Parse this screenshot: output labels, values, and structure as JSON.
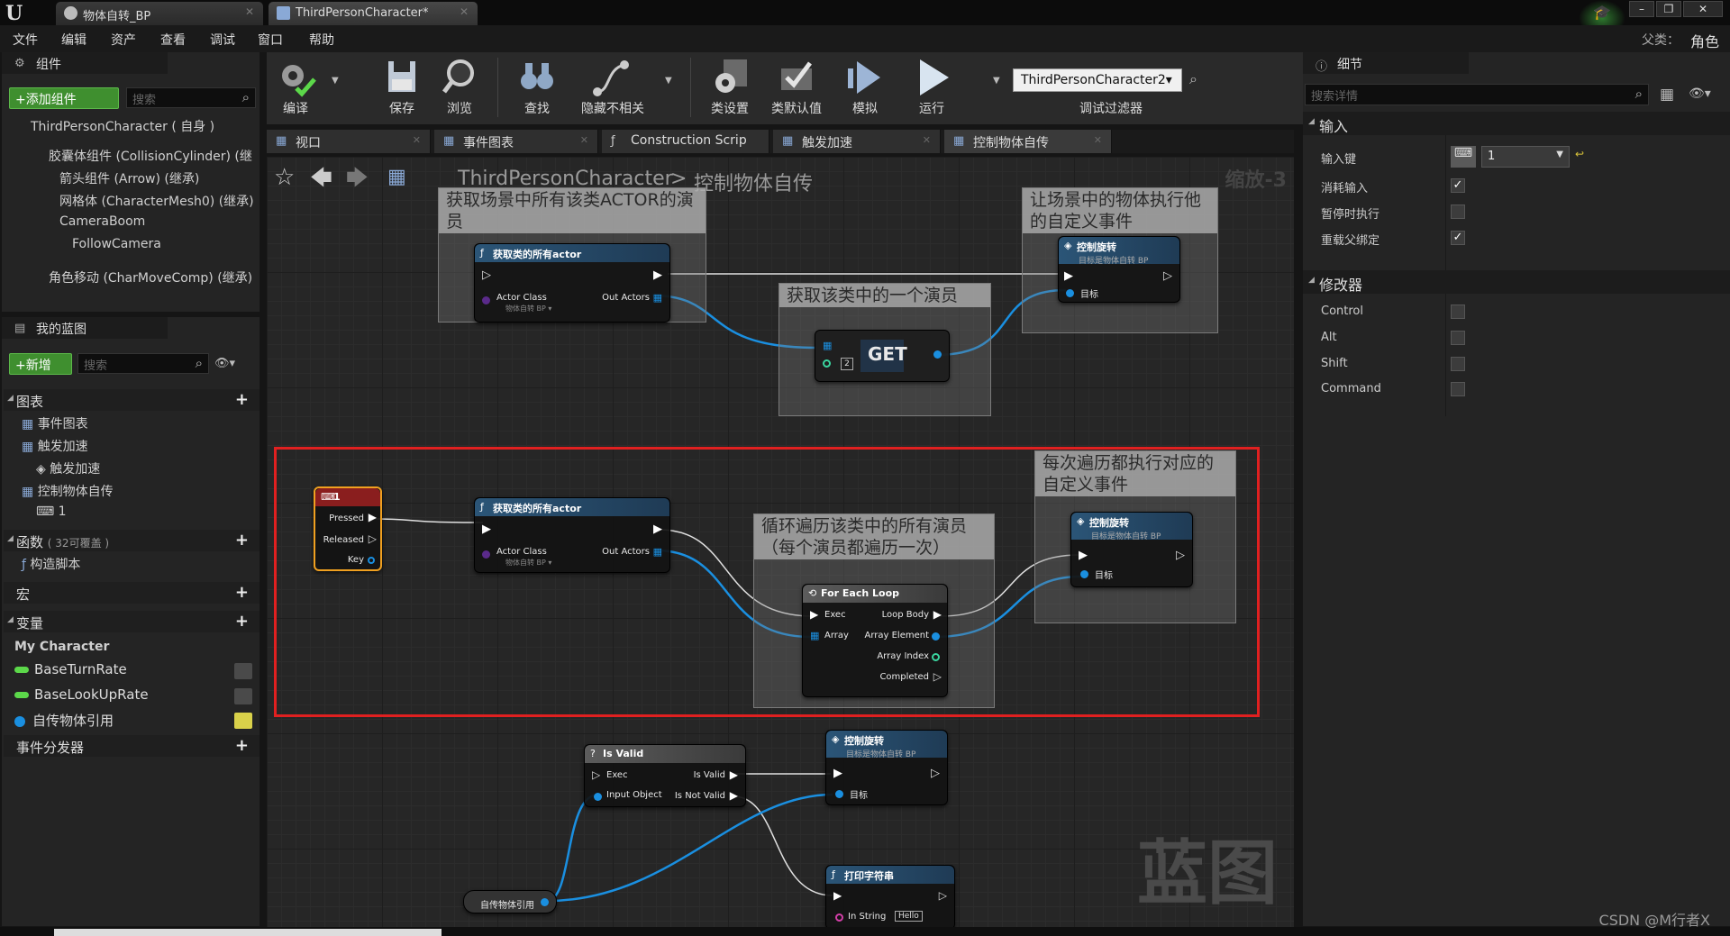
{
  "titlebar": {
    "tabs": [
      {
        "label": "物体自转_BP"
      },
      {
        "label": "ThirdPersonCharacter*"
      }
    ],
    "parent_label": "父类：",
    "parent_value": "角色",
    "window_buttons": [
      "–",
      "❐",
      "✕"
    ]
  },
  "menu": [
    "文件",
    "编辑",
    "资产",
    "查看",
    "调试",
    "窗口",
    "帮助"
  ],
  "components_panel": {
    "title": "组件",
    "add_button": "+添加组件",
    "search_placeholder": "搜索",
    "items": [
      "ThirdPersonCharacter ( 自身 )",
      "胶囊体组件 (CollisionCylinder) (继",
      "箭头组件 (Arrow) (继承)",
      "网格体 (CharacterMesh0) (继承)",
      "CameraBoom",
      "FollowCamera",
      "角色移动 (CharMoveComp) (继承)"
    ]
  },
  "my_blueprint": {
    "title": "我的蓝图",
    "new_button": "+新增",
    "search_placeholder": "搜索",
    "graphs_label": "图表",
    "graphs": [
      "事件图表",
      "触发加速",
      "触发加速",
      "控制物体自传",
      "1"
    ],
    "functions_label": "函数",
    "functions_hint": "( 32可覆盖 )",
    "functions": [
      "构造脚本"
    ],
    "macros_label": "宏",
    "variables_label": "变量",
    "variable_category": "My Character",
    "variables": [
      "BaseTurnRate",
      "BaseLookUpRate",
      "自传物体引用"
    ],
    "dispatchers_label": "事件分发器"
  },
  "toolbar": {
    "tools": [
      "编译",
      "保存",
      "浏览",
      "查找",
      "隐藏不相关",
      "类设置",
      "类默认值",
      "模拟",
      "运行"
    ],
    "debug_dropdown": "ThirdPersonCharacter2▾",
    "debug_label": "调试过滤器"
  },
  "graph_tabs": [
    "视口",
    "事件图表",
    "Construction Scrip",
    "触发加速",
    "控制物体自传"
  ],
  "canvas": {
    "breadcrumb_root": "ThirdPersonCharacter",
    "breadcrumb_sep": ">",
    "breadcrumb_leaf": "控制物体自传",
    "zoom": "缩放-3",
    "watermark": "蓝图",
    "comments": [
      "获取场景中所有该类ACTOR的演员",
      "让场景中的物体执行他的自定义事件",
      "获取该类中的一个演员",
      "每次遍历都执行对应的自定义事件",
      "循环遍历该类中的所有演员（每个演员都遍历一次）"
    ],
    "nodes": {
      "get_all_actors": {
        "title": "获取类的所有actor",
        "actor_class": "Actor Class",
        "class_value": "物体自转 BP ▾",
        "out_actors": "Out Actors"
      },
      "control_rotate": {
        "title": "控制旋转",
        "subtitle": "目标是物体自转 BP",
        "target": "目标"
      },
      "get": {
        "title": "GET",
        "index": "2"
      },
      "input_key": {
        "title": "1",
        "pressed": "Pressed",
        "released": "Released",
        "key": "Key"
      },
      "for_each": {
        "title": "For Each Loop",
        "exec": "Exec",
        "loop_body": "Loop Body",
        "array": "Array",
        "array_element": "Array Element",
        "array_index": "Array Index",
        "completed": "Completed"
      },
      "is_valid": {
        "title": "Is Valid",
        "exec": "Exec",
        "is_valid": "Is Valid",
        "input_object": "Input Object",
        "is_not_valid": "Is Not Valid"
      },
      "print_string": {
        "title": "打印字符串",
        "in_string": "In String",
        "in_value": "Hello"
      },
      "var_ref": {
        "title": "自传物体引用"
      }
    }
  },
  "details_panel": {
    "title": "细节",
    "search_placeholder": "搜索详情",
    "input_section": "输入",
    "input_key_label": "输入键",
    "input_key_value": "1",
    "consume_input": "消耗输入",
    "execute_when_paused": "暂停时执行",
    "override_parent": "重载父绑定",
    "modifiers_section": "修改器",
    "modifiers": [
      "Control",
      "Alt",
      "Shift",
      "Command"
    ]
  },
  "footer": {
    "credit": "CSDN @M行者X"
  },
  "colors": {
    "accent_red": "#e02020",
    "exec_white": "#ffffff",
    "object_blue": "#1a8fe0",
    "class_purple": "#5a2a8a",
    "int_green": "#3ad6a0"
  }
}
